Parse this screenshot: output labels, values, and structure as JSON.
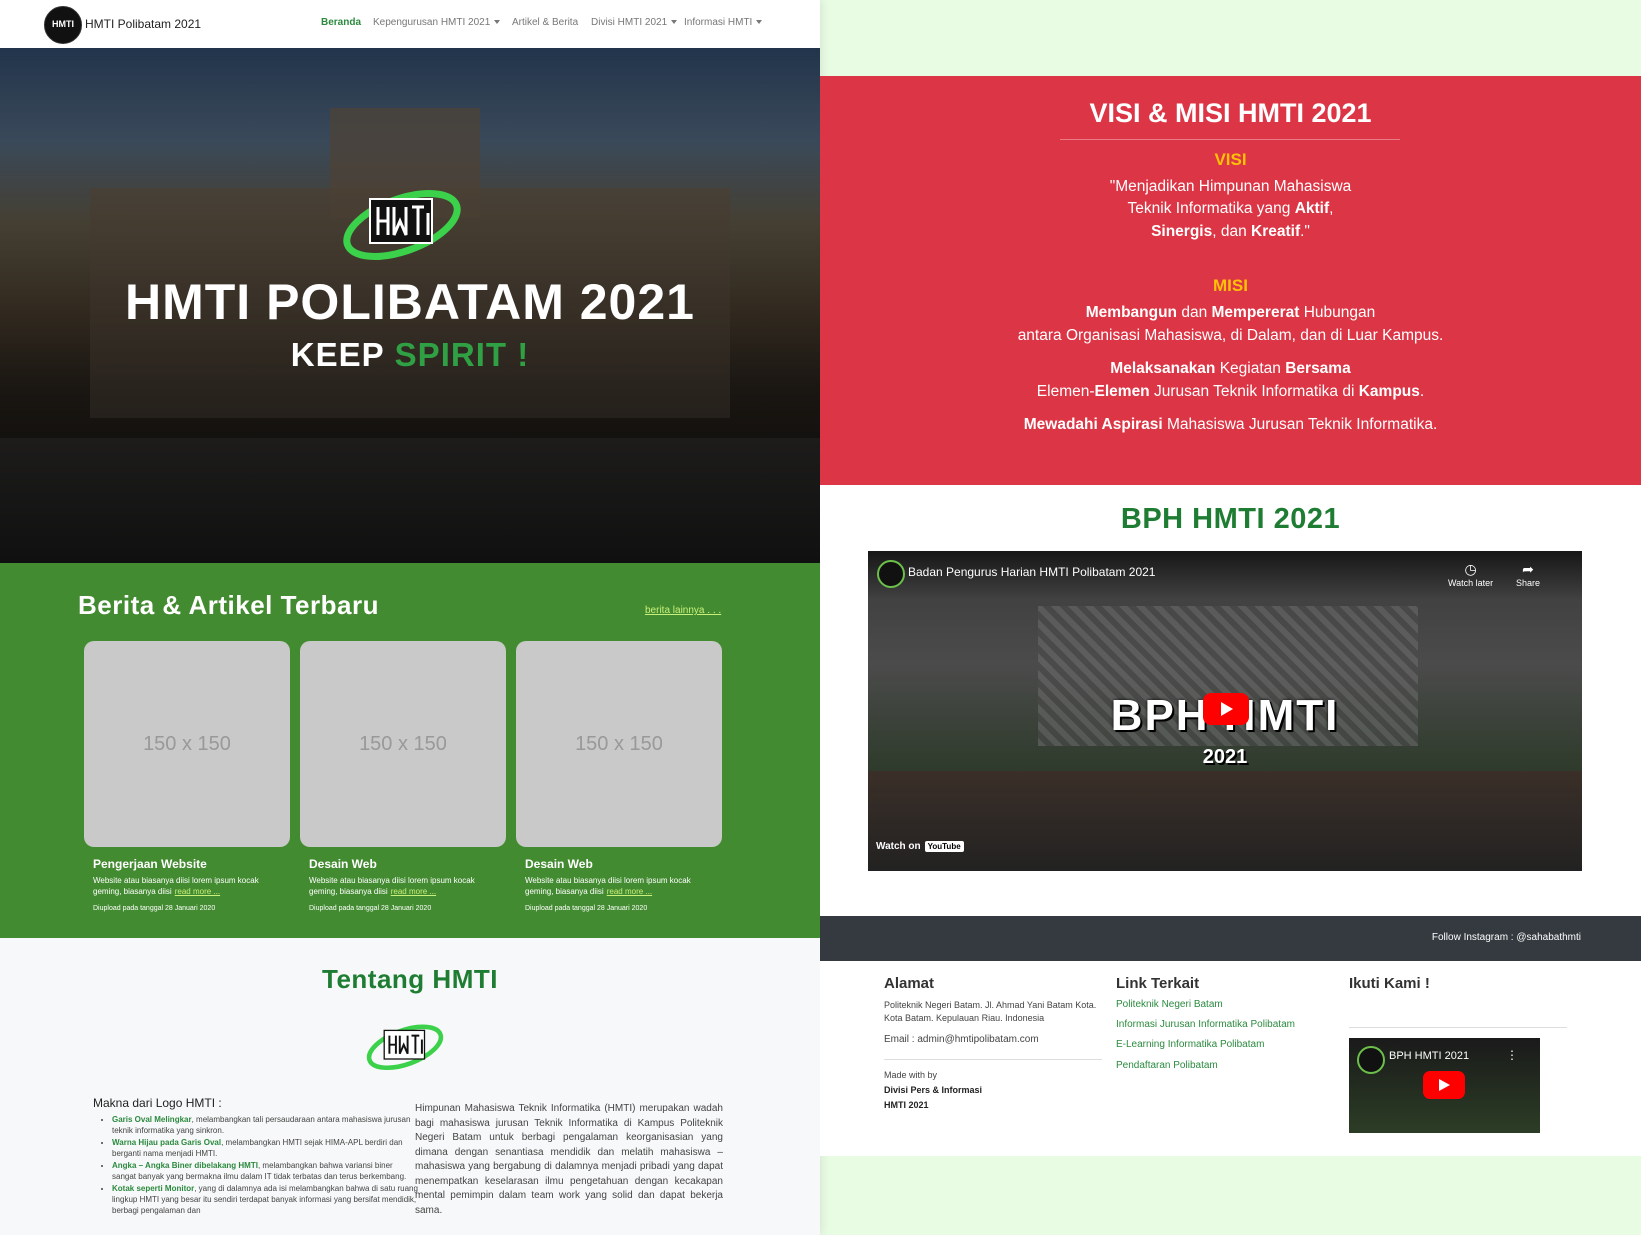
{
  "navbar": {
    "brand": "HMTI Polibatam 2021",
    "logo_text": "HMTI",
    "items": [
      {
        "label": "Beranda",
        "active": true
      },
      {
        "label": "Kepengurusan HMTI 2021",
        "dropdown": true
      },
      {
        "label": "Artikel & Berita"
      },
      {
        "label": "Divisi HMTI 2021",
        "dropdown": true
      },
      {
        "label": "Informasi HMTI",
        "dropdown": true
      }
    ]
  },
  "hero": {
    "title": "HMTI POLIBATAM 2021",
    "subtitle_white": "KEEP",
    "subtitle_green": "SPIRIT !"
  },
  "news": {
    "title": "Berita & Artikel Terbaru",
    "more_link": "berita lainnya . . .",
    "cards": [
      {
        "thumb": "150 x 150",
        "title": "Pengerjaan Website",
        "desc": "Website atau biasanya diisi lorem ipsum kocak geming, biasanya diisi",
        "read_more": "read more ...",
        "date": "Diupload pada tanggal 28 Januari 2020"
      },
      {
        "thumb": "150 x 150",
        "title": "Desain Web",
        "desc": "Website atau biasanya diisi lorem ipsum kocak geming, biasanya diisi",
        "read_more": "read more ...",
        "date": "Diupload pada tanggal 28 Januari 2020"
      },
      {
        "thumb": "150 x 150",
        "title": "Desain Web",
        "desc": "Website atau biasanya diisi lorem ipsum kocak geming, biasanya diisi",
        "read_more": "read more ...",
        "date": "Diupload pada tanggal 28 Januari 2020"
      }
    ]
  },
  "about": {
    "title": "Tentang HMTI",
    "makna_title": "Makna dari Logo HMTI :",
    "makna": [
      {
        "bold": "Garis Oval Melingkar",
        "text": ", melambangkan tali persaudaraan antara mahasiswa jurusan teknik informatika yang sinkron."
      },
      {
        "bold": "Warna Hijau pada Garis Oval",
        "text": ", melambangkan HMTI sejak HIMA-APL berdiri dan berganti nama menjadi HMTI."
      },
      {
        "bold": "Angka – Angka Biner dibelakang HMTI",
        "text": ", melambangkan bahwa variansi biner sangat banyak yang bermakna ilmu dalam IT tidak terbatas dan terus berkembang."
      },
      {
        "bold": "Kotak seperti Monitor",
        "text": ", yang di dalamnya ada isi melambangkan bahwa di satu ruang lingkup HMTI yang besar itu sendiri terdapat banyak informasi yang bersifat mendidik, berbagi pengalaman dan"
      }
    ],
    "text": "Himpunan Mahasiswa Teknik Informatika (HMTI) merupakan wadah bagi mahasiswa jurusan Teknik Informatika di Kampus Politeknik Negeri Batam untuk berbagi pengalaman keorganisasian yang dimana dengan senantiasa mendidik dan melatih mahasiswa – mahasiswa yang bergabung di dalamnya menjadi pribadi yang dapat menempatkan keselarasan ilmu pengetahuan dengan kecakapan mental pemimpin dalam team work yang solid dan dapat bekerja sama."
  },
  "visi_misi": {
    "title": "VISI & MISI HMTI 2021",
    "visi_label": "VISI",
    "visi_l1": "\"Menjadikan Himpunan Mahasiswa",
    "visi_l2_a": "Teknik Informatika yang ",
    "visi_l2_b": "Aktif",
    "visi_l2_c": ",",
    "visi_l3_a": "Sinergis",
    "visi_l3_b": ", dan ",
    "visi_l3_c": "Kreatif",
    "visi_l3_d": ".\"",
    "misi_label": "MISI",
    "m1_a": "Membangun",
    "m1_b": " dan ",
    "m1_c": "Mempererat",
    "m1_d": " Hubungan",
    "m1_l2": "antara Organisasi Mahasiswa, di Dalam, dan di Luar Kampus.",
    "m2_a": "Melaksanakan",
    "m2_b": " Kegiatan ",
    "m2_c": "Bersama",
    "m2_l2_a": "Elemen-",
    "m2_l2_b": "Elemen",
    "m2_l2_c": " Jurusan Teknik Informatika di ",
    "m2_l2_d": "Kampus",
    "m2_l2_e": ".",
    "m3_a": "Mewadahi Aspirasi",
    "m3_b": " Mahasiswa Jurusan Teknik Informatika."
  },
  "bph": {
    "title": "BPH HMTI 2021",
    "video_title": "Badan Pengurus Harian HMTI Polibatam 2021",
    "watch_later": "Watch later",
    "share": "Share",
    "overlay_text": "BPH HMTI",
    "overlay_year": "2021",
    "watch_on": "Watch on",
    "youtube": "YouTube"
  },
  "footer": {
    "instagram": "Follow Instagram : @sahabathmti",
    "alamat_title": "Alamat",
    "alamat_text": "Politeknik Negeri Batam. Jl. Ahmad Yani Batam Kota. Kota Batam. Kepulauan Riau. Indonesia",
    "email": "Email : admin@hmtipolibatam.com",
    "made_with": "Made with by",
    "made_by_1": "Divisi Pers & Informasi",
    "made_by_2": "HMTI 2021",
    "links_title": "Link Terkait",
    "links": [
      "Politeknik Negeri Batam",
      "Informasi Jurusan Informatika Polibatam",
      "E-Learning Informatika Polibatam",
      "Pendaftaran Polibatam"
    ],
    "follow_title": "Ikuti Kami !",
    "follow_video_title": "BPH HMTI 2021"
  },
  "colors": {
    "primary_green": "#438b31",
    "dark_green": "#1e7d32",
    "red": "#dc3545",
    "yellow": "#ffc107",
    "dark_bar": "#343a40"
  },
  "icons": [
    "clock-icon",
    "share-icon",
    "play-icon",
    "caret-down-icon",
    "more-vert-icon"
  ]
}
